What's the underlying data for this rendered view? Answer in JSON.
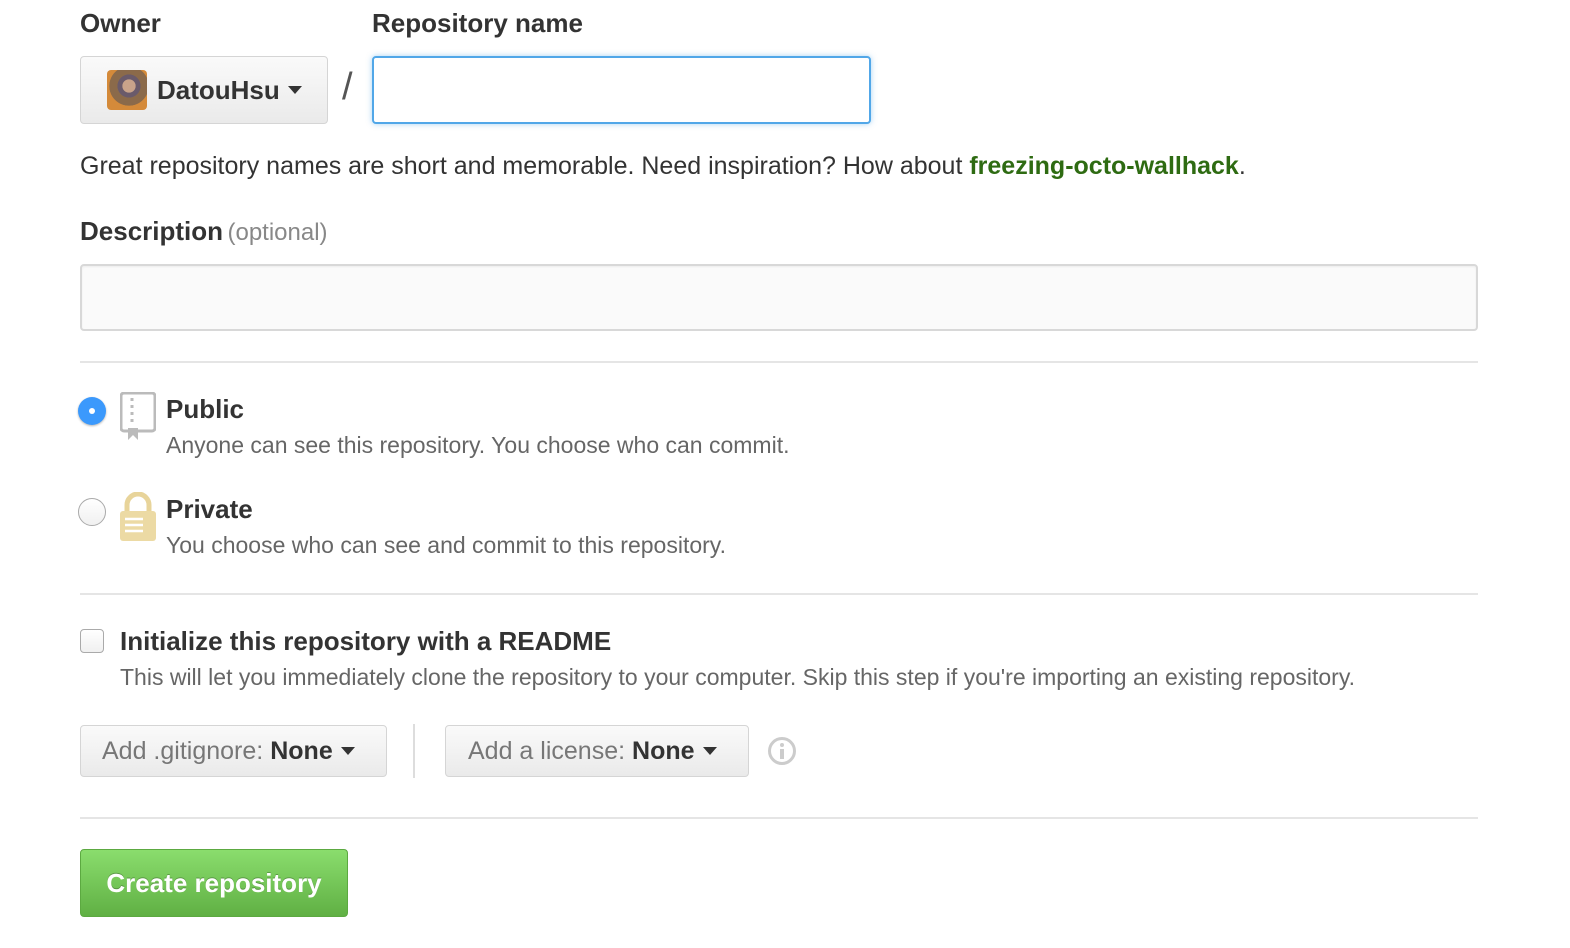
{
  "form": {
    "owner_label": "Owner",
    "owner_name": "DatouHsu",
    "separator": "/",
    "repo_name_label": "Repository name",
    "repo_name_value": "",
    "hint_prefix": "Great repository names are short and memorable. Need inspiration? How about ",
    "hint_suggestion": "freezing-octo-wallhack",
    "hint_suffix": ".",
    "description_label": "Description",
    "description_optional": "(optional)",
    "description_value": ""
  },
  "visibility": {
    "selected": "public",
    "options": [
      {
        "id": "public",
        "title": "Public",
        "description": "Anyone can see this repository. You choose who can commit.",
        "icon": "repo-book-icon"
      },
      {
        "id": "private",
        "title": "Private",
        "description": "You choose who can see and commit to this repository.",
        "icon": "lock-icon"
      }
    ]
  },
  "init": {
    "checked": false,
    "title": "Initialize this repository with a README",
    "description": "This will let you immediately clone the repository to your computer. Skip this step if you're importing an existing repository."
  },
  "gitignore": {
    "label": "Add .gitignore:",
    "value": "None"
  },
  "license": {
    "label": "Add a license:",
    "value": "None",
    "info_icon": "info-icon"
  },
  "submit": {
    "label": "Create repository"
  },
  "colors": {
    "accent_blue": "#4a90e2",
    "suggestion_green": "#2e6b12",
    "button_green_top": "#8add6d",
    "button_green_bottom": "#60b044"
  }
}
